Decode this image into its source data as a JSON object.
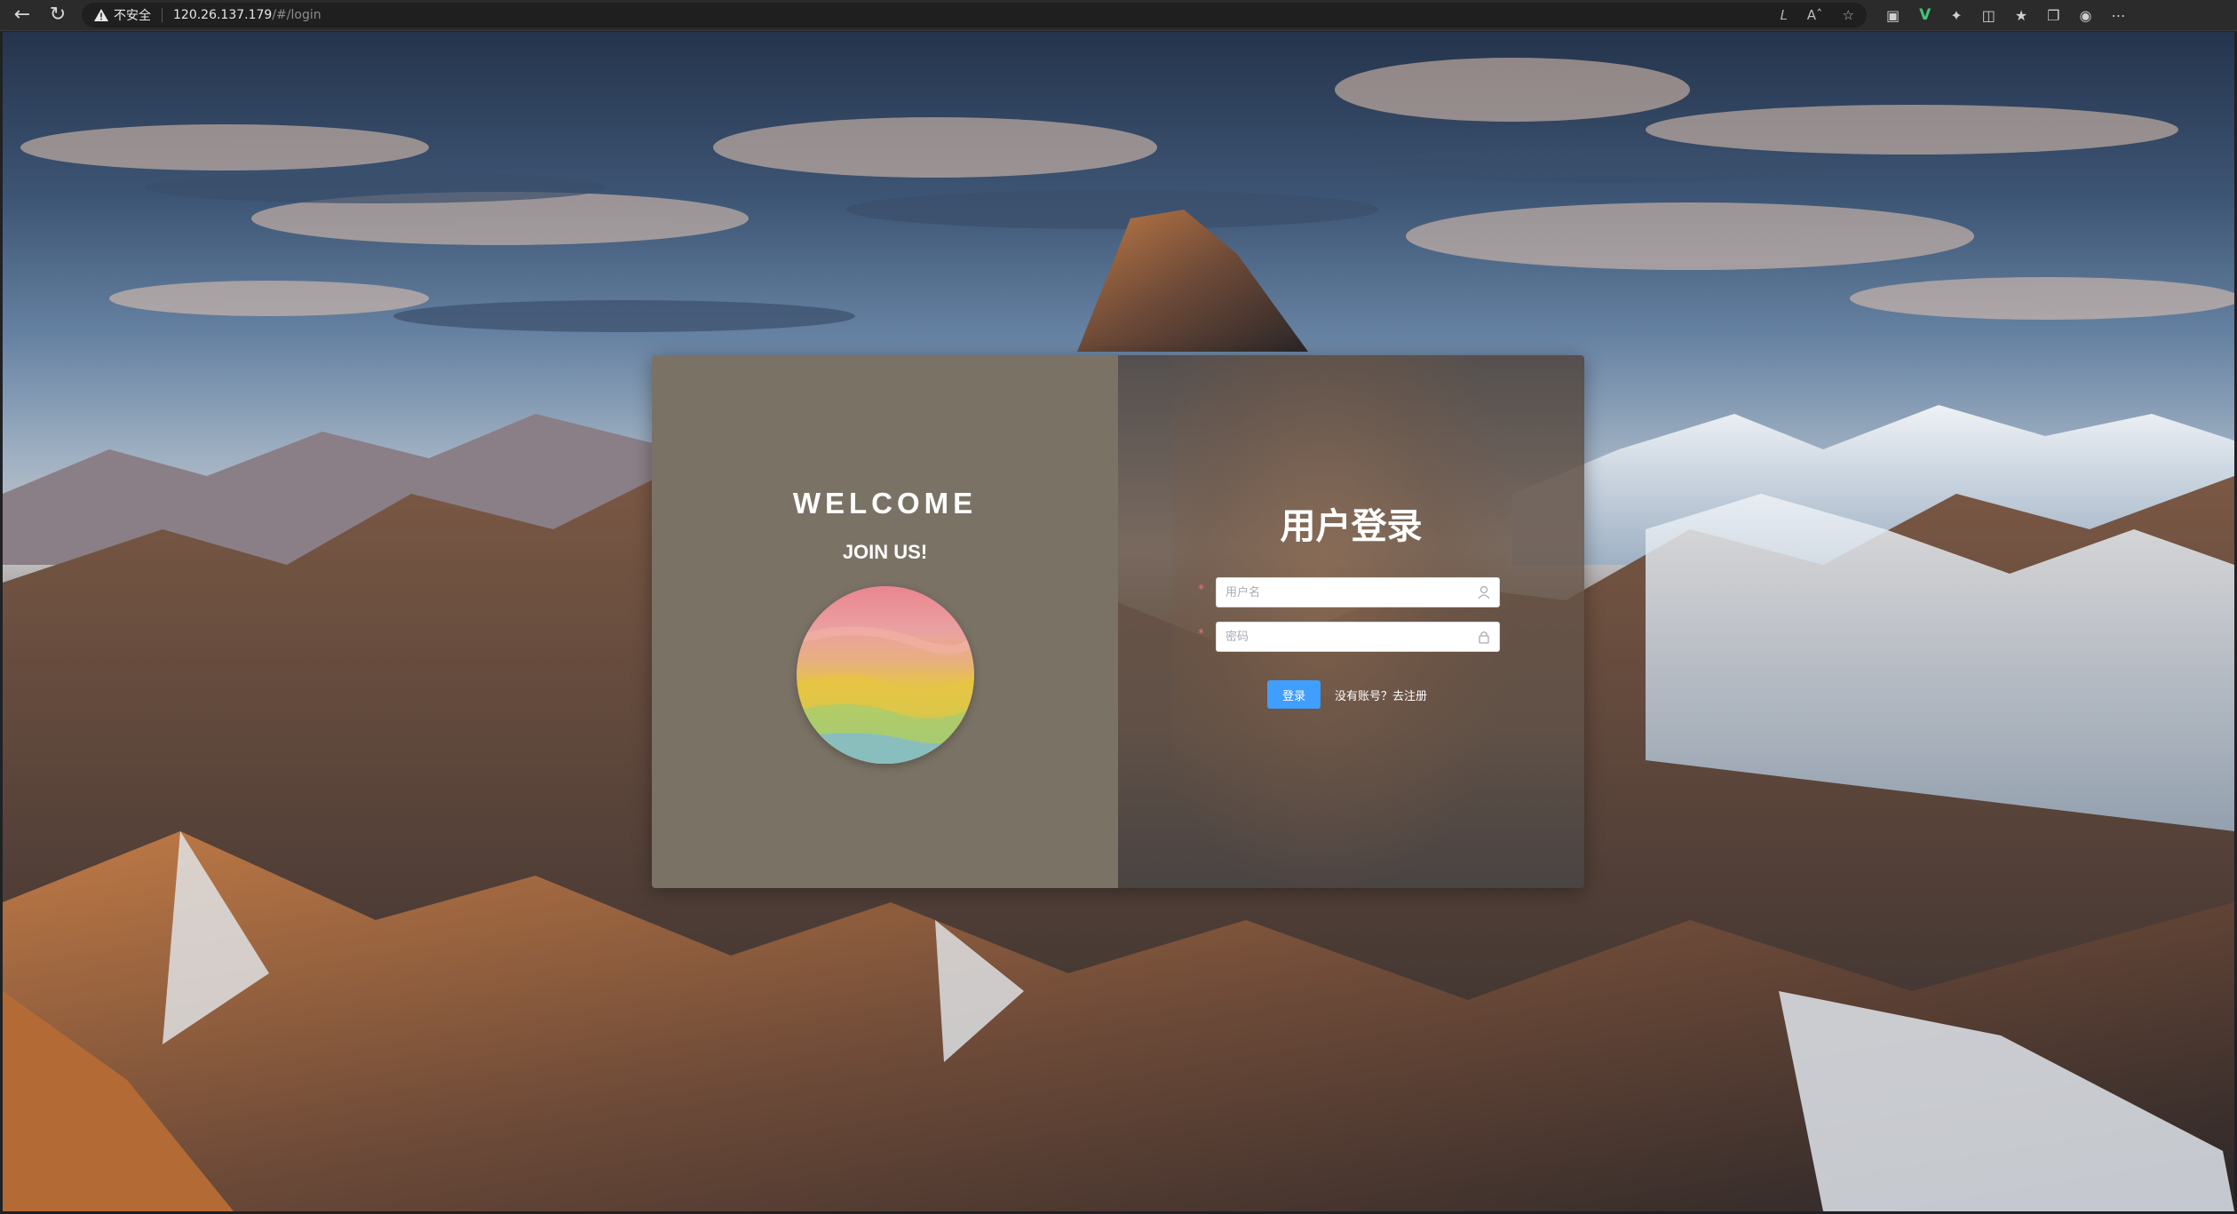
{
  "browser": {
    "security_label": "不安全",
    "url_host": "120.26.137.179",
    "url_path": "/#/login",
    "icons": [
      "back-icon",
      "reload-icon",
      "warning-icon",
      "read-aloud-icon",
      "text-size-icon",
      "favorite-star-icon",
      "screenshot-icon",
      "vue-devtools-icon",
      "extensions-icon",
      "split-screen-icon",
      "favorites-icon",
      "collections-icon",
      "copilot-icon",
      "more-icon"
    ]
  },
  "login": {
    "welcome": "WELCOME",
    "join": "JOIN US!",
    "title": "用户登录",
    "username_placeholder": "用户名",
    "password_placeholder": "密码",
    "required_mark": "*",
    "submit_label": "登录",
    "register_link": "没有账号？去注册"
  },
  "colors": {
    "accent": "#409eff",
    "required": "#f56c6c",
    "left_panel": "#7b7266"
  }
}
